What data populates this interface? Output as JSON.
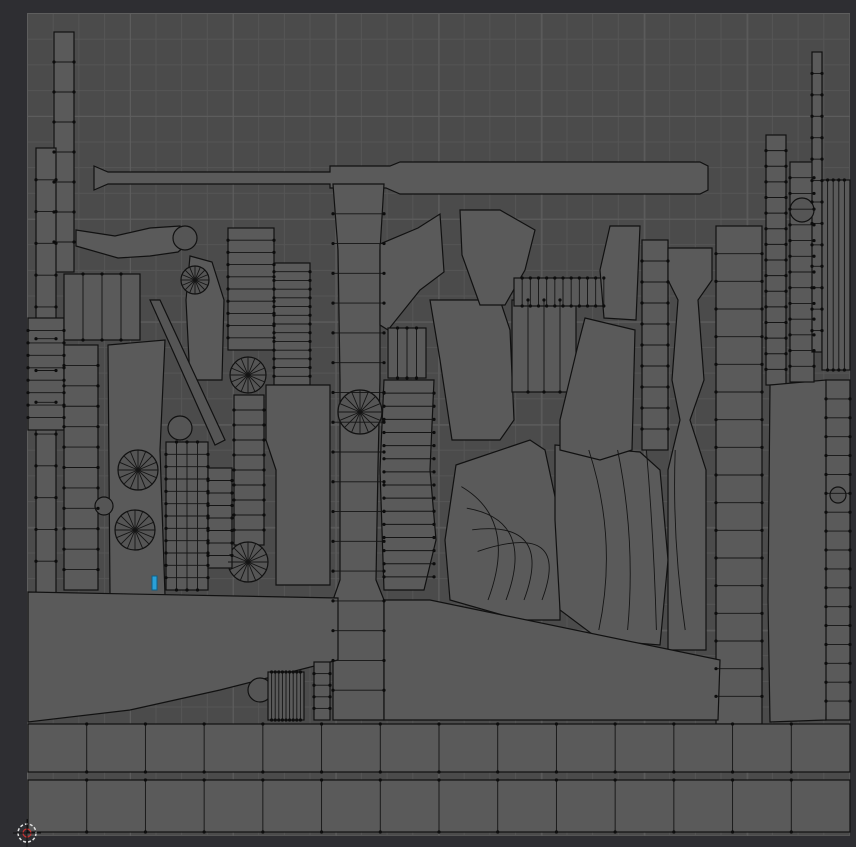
{
  "editor": {
    "name": "UV Editor",
    "grid_divisions": 8
  },
  "colors": {
    "background": "#2e2e32",
    "uv_area": "#4b4b4b",
    "island_fill": "#5a5a5a",
    "edge": "#111111",
    "selected_face": "#2aa0d8",
    "cursor": "#e0e0e0"
  },
  "icons": {
    "cursor": "2d-cursor-icon"
  }
}
